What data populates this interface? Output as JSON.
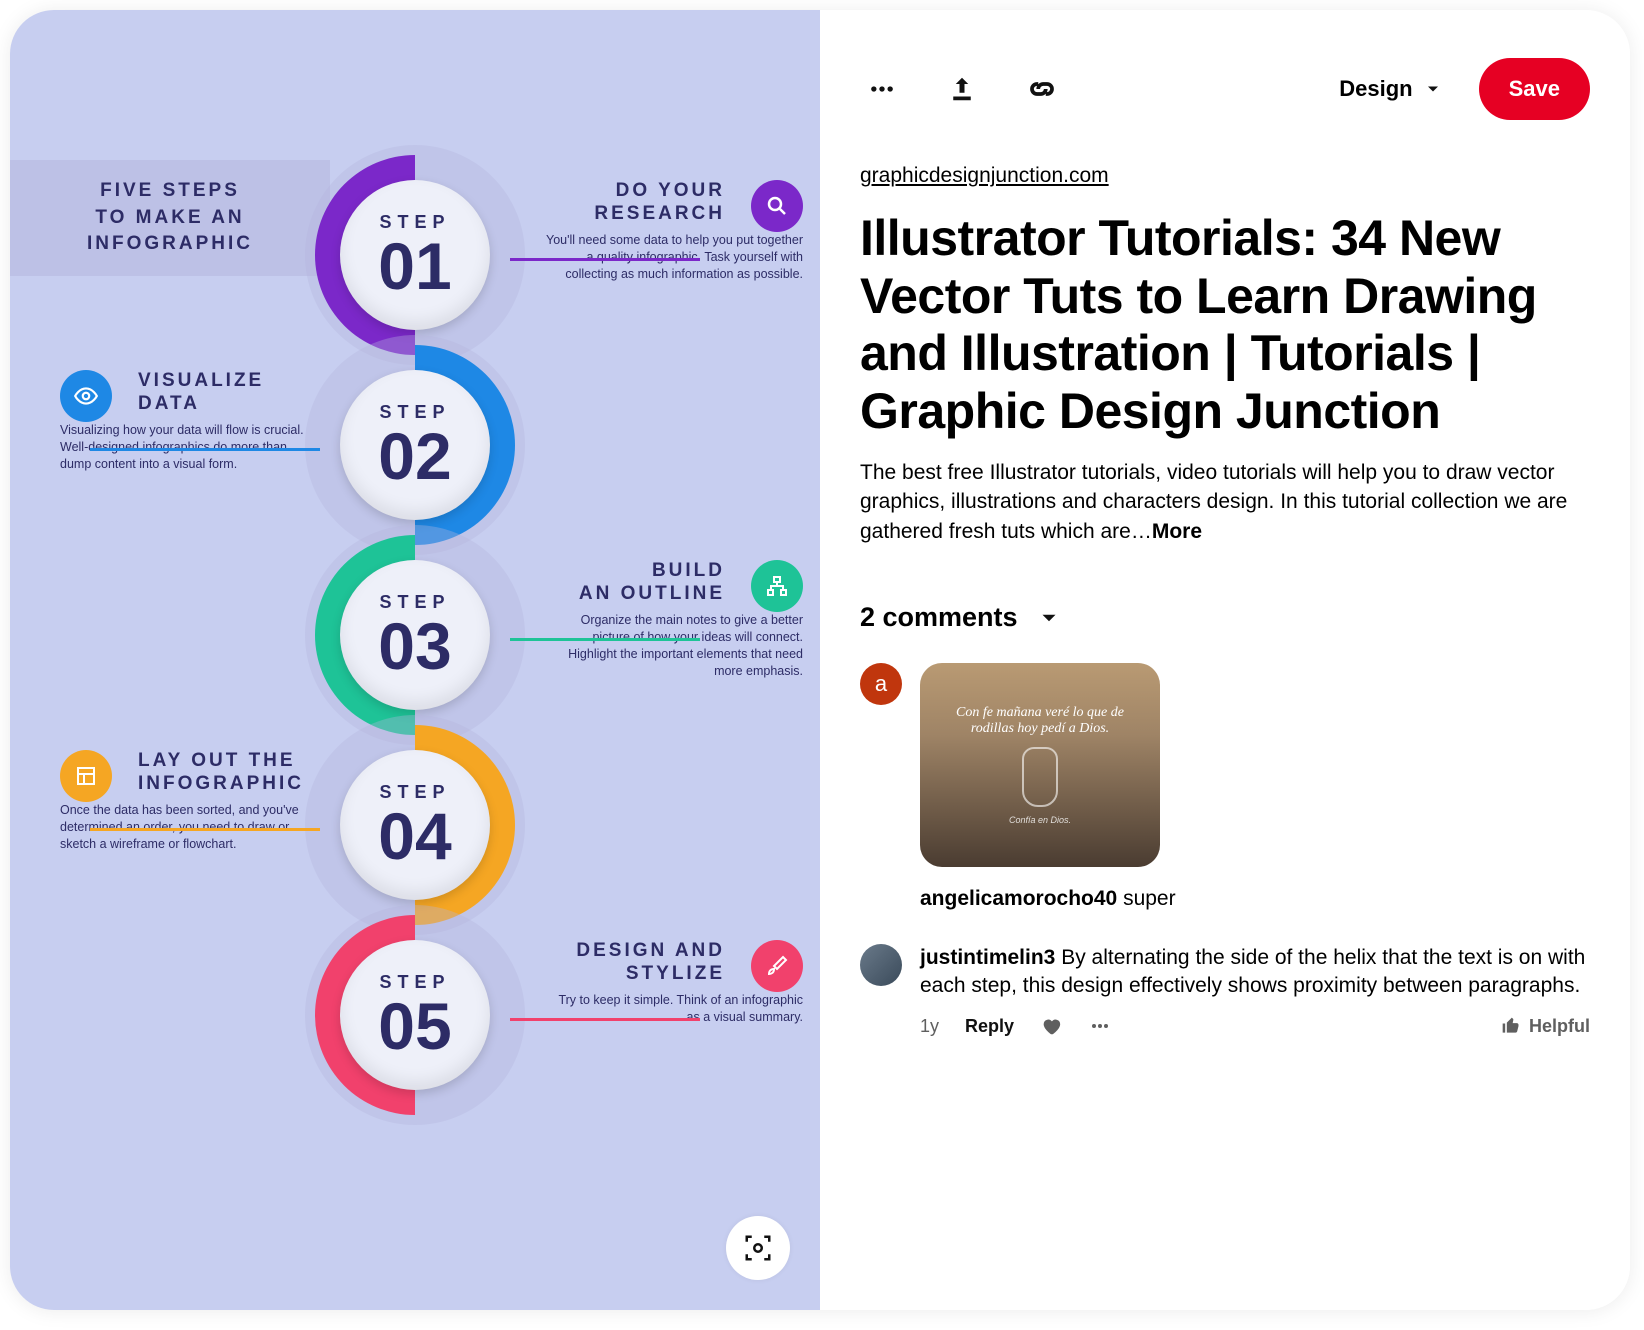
{
  "infographic": {
    "title_lines": [
      "FIVE STEPS",
      "TO MAKE AN",
      "INFOGRAPHIC"
    ],
    "step_label": "STEP",
    "steps": [
      {
        "num": "01",
        "color": "#7B28C9",
        "side": "right",
        "icon": "search-icon",
        "head": "DO YOUR\nRESEARCH",
        "body": "You'll need some data to help you put together a quality infographic. Task yourself with collecting as much information as possible."
      },
      {
        "num": "02",
        "color": "#1E88E5",
        "side": "left",
        "icon": "eye-icon",
        "head": "VISUALIZE\nDATA",
        "body": "Visualizing how your data will flow is crucial. Well-designed infographics do more than dump content into a visual form."
      },
      {
        "num": "03",
        "color": "#1EC397",
        "side": "right",
        "icon": "sitemap-icon",
        "head": "BUILD\nAN OUTLINE",
        "body": "Organize the main notes to give a better picture of how your ideas will connect. Highlight the important elements that need more emphasis."
      },
      {
        "num": "04",
        "color": "#F5A623",
        "side": "left",
        "icon": "layout-icon",
        "head": "LAY OUT THE\nINFOGRAPHIC",
        "body": "Once the data has been sorted, and you've determined an order, you need to draw or sketch a wireframe or flowchart."
      },
      {
        "num": "05",
        "color": "#F1416C",
        "side": "right",
        "icon": "brush-icon",
        "head": "DESIGN AND\nSTYLIZE",
        "body": "Try to keep it simple. Think of an infographic as a visual summary."
      }
    ]
  },
  "toolbar": {
    "board_label": "Design",
    "save_label": "Save"
  },
  "source_link": "graphicdesignjunction.com",
  "pin_title": "Illustrator Tutorials: 34 New Vector Tuts to Learn Drawing and Illustration | Tutorials | Graphic Design Junction",
  "pin_desc": "The best free Illustrator tutorials, video tutorials will help you to draw vector graphics, illustrations and characters design. In this tutorial collection we are gathered fresh tuts which are…",
  "more_label": "More",
  "comments": {
    "header": "2 comments",
    "items": [
      {
        "avatar_letter": "a",
        "user": "angelicamorocho40",
        "text": "super",
        "thumb_text": "Con fe mañana veré lo que de rodillas hoy pedí a Dios.",
        "thumb_footer": "Confía en Dios."
      },
      {
        "avatar_letter": "",
        "user": "justintimelin3",
        "text": "By alternating the side of the helix that the text is on with each step, this design effectively shows proximity between paragraphs.",
        "age": "1y",
        "reply_label": "Reply",
        "helpful_label": "Helpful"
      }
    ]
  }
}
